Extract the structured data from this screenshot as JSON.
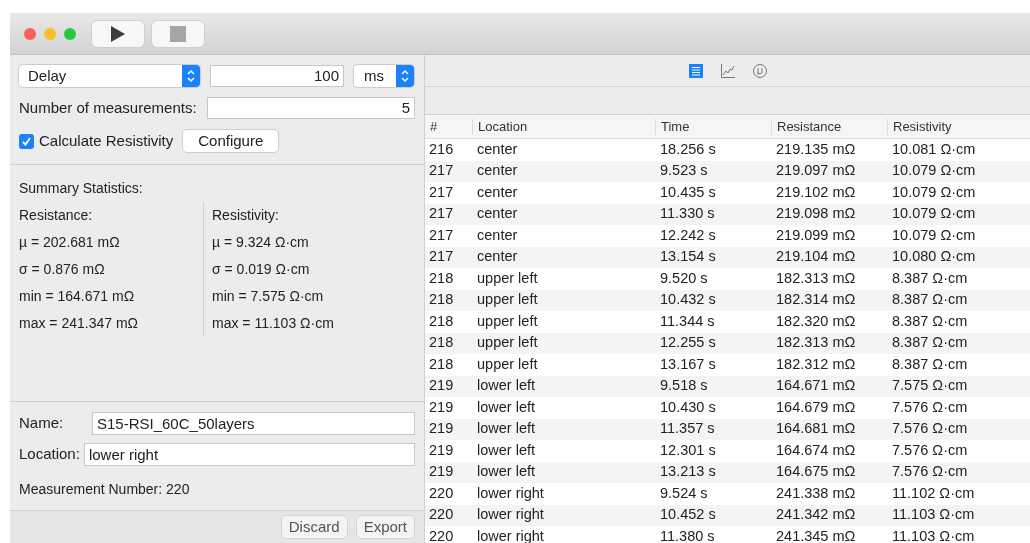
{
  "toolbar": {
    "run_buttons": [
      {
        "kind": "play",
        "disabled": false
      },
      {
        "kind": "stop",
        "disabled": true
      }
    ]
  },
  "settings": {
    "delay_mode": "Delay",
    "delay_value": "100",
    "delay_unit": "ms",
    "measurements_label": "Number of measurements:",
    "measurements_value": "5",
    "calculate_resistivity": {
      "label": "Calculate Resistivity",
      "checked": true
    },
    "configure_button": "Configure"
  },
  "summary": {
    "title": "Summary Statistics:",
    "columns": [
      {
        "heading": "Resistance:",
        "lines": [
          "µ = 202.681 mΩ",
          "σ = 0.876 mΩ",
          "min = 164.671 mΩ",
          "max = 241.347 mΩ"
        ]
      },
      {
        "heading": "Resistivity:",
        "lines": [
          "µ = 9.324 Ω·cm",
          "σ = 0.019 Ω·cm",
          "min = 7.575 Ω·cm",
          "max = 11.103 Ω·cm"
        ]
      }
    ]
  },
  "sample": {
    "name_label": "Name:",
    "name_value": "S15-RSI_60C_50layers",
    "location_label": "Location:",
    "location_value": "lower right",
    "measurement_number": "Measurement Number: 220"
  },
  "footer_buttons": [
    "Discard",
    "Export"
  ],
  "view_tabs": [
    {
      "kind": "table",
      "selected": true
    },
    {
      "kind": "chart",
      "selected": false
    },
    {
      "kind": "stats",
      "selected": false
    }
  ],
  "table": {
    "columns": [
      "#",
      "Location",
      "Time",
      "Resistance",
      "Resistivity"
    ],
    "rows": [
      [
        "216",
        "center",
        "18.256 s",
        "219.135 mΩ",
        "10.081 Ω·cm"
      ],
      [
        "217",
        "center",
        "9.523 s",
        "219.097 mΩ",
        "10.079 Ω·cm"
      ],
      [
        "217",
        "center",
        "10.435 s",
        "219.102 mΩ",
        "10.079 Ω·cm"
      ],
      [
        "217",
        "center",
        "11.330 s",
        "219.098 mΩ",
        "10.079 Ω·cm"
      ],
      [
        "217",
        "center",
        "12.242 s",
        "219.099 mΩ",
        "10.079 Ω·cm"
      ],
      [
        "217",
        "center",
        "13.154 s",
        "219.104 mΩ",
        "10.080 Ω·cm"
      ],
      [
        "218",
        "upper left",
        "9.520 s",
        "182.313 mΩ",
        "8.387 Ω·cm"
      ],
      [
        "218",
        "upper left",
        "10.432 s",
        "182.314 mΩ",
        "8.387 Ω·cm"
      ],
      [
        "218",
        "upper left",
        "11.344 s",
        "182.320 mΩ",
        "8.387 Ω·cm"
      ],
      [
        "218",
        "upper left",
        "12.255 s",
        "182.313 mΩ",
        "8.387 Ω·cm"
      ],
      [
        "218",
        "upper left",
        "13.167 s",
        "182.312 mΩ",
        "8.387 Ω·cm"
      ],
      [
        "219",
        "lower left",
        "9.518 s",
        "164.671 mΩ",
        "7.575 Ω·cm"
      ],
      [
        "219",
        "lower left",
        "10.430 s",
        "164.679 mΩ",
        "7.576 Ω·cm"
      ],
      [
        "219",
        "lower left",
        "11.357 s",
        "164.681 mΩ",
        "7.576 Ω·cm"
      ],
      [
        "219",
        "lower left",
        "12.301 s",
        "164.674 mΩ",
        "7.576 Ω·cm"
      ],
      [
        "219",
        "lower left",
        "13.213 s",
        "164.675 mΩ",
        "7.576 Ω·cm"
      ],
      [
        "220",
        "lower right",
        "9.524 s",
        "241.338 mΩ",
        "11.102 Ω·cm"
      ],
      [
        "220",
        "lower right",
        "10.452 s",
        "241.342 mΩ",
        "11.103 Ω·cm"
      ],
      [
        "220",
        "lower right",
        "11.380 s",
        "241.345 mΩ",
        "11.103 Ω·cm"
      ]
    ]
  }
}
